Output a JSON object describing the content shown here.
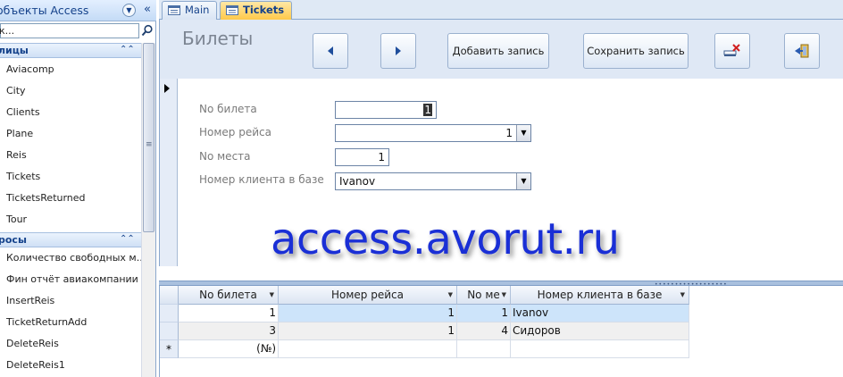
{
  "nav": {
    "title": "объекты Access",
    "search_value": "к...",
    "groups": [
      {
        "label": "лицы",
        "items": [
          "Aviacomp",
          "City",
          "Clients",
          "Plane",
          "Reis",
          "Tickets",
          "TicketsReturned",
          "Tour"
        ]
      },
      {
        "label": "росы",
        "items": [
          "Количество свободных м...",
          "Фин отчёт авиакомпании",
          "InsertReis",
          "TicketReturnAdd",
          "DeleteReis",
          "DeleteReis1"
        ]
      }
    ]
  },
  "tabs": [
    {
      "label": "Main",
      "active": false
    },
    {
      "label": "Tickets",
      "active": true
    }
  ],
  "form": {
    "title": "Билеты",
    "buttons": {
      "add_record": "Добавить запись",
      "save_record": "Сохранить запись"
    },
    "fields": {
      "ticket_no": {
        "label": "No билета",
        "value": "1"
      },
      "flight_no": {
        "label": "Номер рейса",
        "value": "1"
      },
      "seat_no": {
        "label": "No места",
        "value": "1"
      },
      "client_no": {
        "label": "Номер клиента в базе",
        "value": "Ivanov"
      }
    },
    "watermark": "access.avorut.ru"
  },
  "datasheet": {
    "columns": [
      "No билета",
      "Номер рейса",
      "No ме",
      "Номер клиента в базе"
    ],
    "rows": [
      {
        "ticket": "1",
        "flight": "1",
        "seat": "1",
        "client": "Ivanov"
      },
      {
        "ticket": "3",
        "flight": "1",
        "seat": "4",
        "client": "Сидоров"
      }
    ],
    "new_row": {
      "marker": "*",
      "ticket": "(№)"
    }
  },
  "colors": {
    "accent": "#15428b",
    "tab_active": "#ffc94a",
    "form_header": "#dfe8f5",
    "watermark": "#1a2fd6",
    "selected_row": "#cde4fa"
  }
}
